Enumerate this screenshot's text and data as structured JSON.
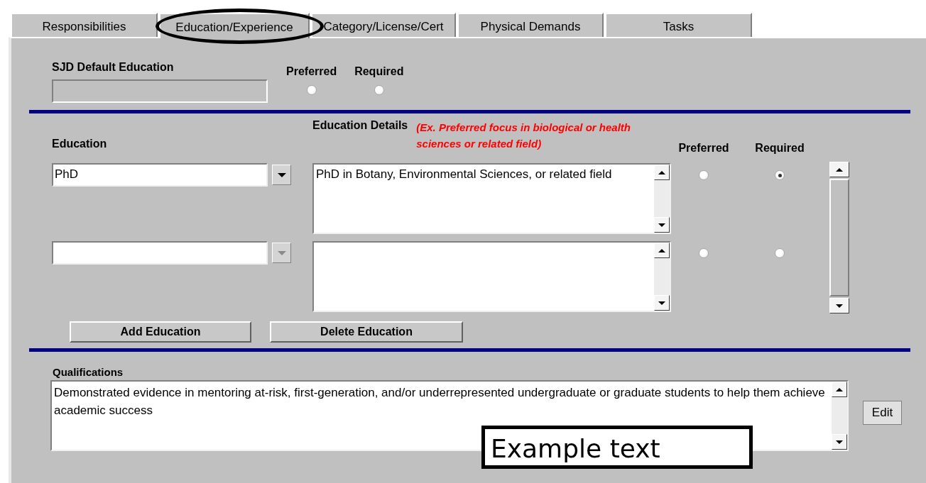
{
  "tabs": [
    {
      "label": "Responsibilities",
      "selected": false,
      "circled": false
    },
    {
      "label": "Education/Experience",
      "selected": true,
      "circled": true
    },
    {
      "label": "Category/License/Cert",
      "selected": false,
      "circled": false
    },
    {
      "label": "Physical Demands",
      "selected": false,
      "circled": false
    },
    {
      "label": "Tasks",
      "selected": false,
      "circled": false
    }
  ],
  "default_education": {
    "label": "SJD Default Education",
    "preferred_label": "Preferred",
    "required_label": "Required",
    "preferred": false,
    "required": false
  },
  "education": {
    "label": "Education",
    "details_label": "Education Details",
    "details_hint": "(Ex. Preferred focus in biological or health sciences or related field)",
    "preferred_label": "Preferred",
    "required_label": "Required",
    "rows": [
      {
        "education": "PhD",
        "details": "PhD in Botany, Environmental Sciences, or related field",
        "dropdown_disabled": false,
        "preferred": false,
        "required": true
      },
      {
        "dropdown_disabled": true,
        "preferred": false,
        "required": false
      }
    ]
  },
  "buttons": [
    "Add Education",
    "Delete Education"
  ],
  "qualifications": {
    "label": "Qualifications",
    "value": "Demonstrated evidence in mentoring at-risk, first-generation, and/or underrepresented undergraduate or graduate students to help them achieve academic success",
    "edit_button": "Edit"
  },
  "callout": {
    "text": "Example text"
  }
}
